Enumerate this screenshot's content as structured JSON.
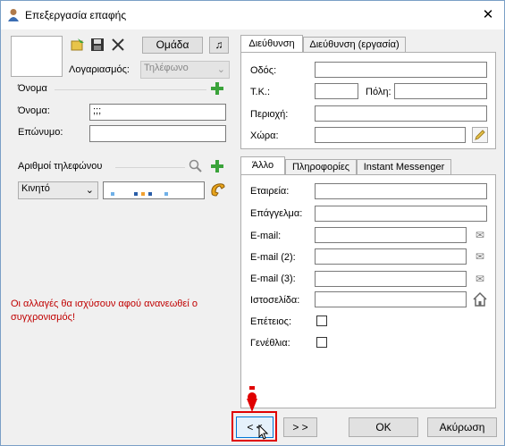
{
  "window": {
    "title": "Επεξεργασία επαφής",
    "close": "✕"
  },
  "left": {
    "group_button": "Ομάδα",
    "account_label": "Λογαριασμός:",
    "account_value": "Τηλέφωνο",
    "name_section": "Όνομα",
    "first_name_label": "Όνομα:",
    "first_name_value": ";;;",
    "last_name_label": "Επώνυμο:",
    "last_name_value": "",
    "phones_section": "Αριθμοί τηλεφώνου",
    "phone_type": "Κινητό",
    "sync_notice": "Οι αλλαγές θα ισχύσουν αφού ανανεωθεί ο συγχρονισμός!"
  },
  "address_tabs": [
    "Διεύθυνση",
    "Διεύθυνση (εργασία)"
  ],
  "address": {
    "street_label": "Οδός:",
    "zip_label": "Τ.Κ.:",
    "city_label": "Πόλη:",
    "region_label": "Περιοχή:",
    "country_label": "Χώρα:"
  },
  "other_tabs": [
    "Άλλο",
    "Πληροφορίες",
    "Instant Messenger"
  ],
  "other": {
    "company_label": "Εταιρεία:",
    "job_label": "Επάγγελμα:",
    "email_label": "E-mail:",
    "email2_label": "E-mail (2):",
    "email3_label": "E-mail (3):",
    "website_label": "Ιστοσελίδα:",
    "anniversary_label": "Επέτειος:",
    "birthday_label": "Γενέθλια:"
  },
  "footer": {
    "prev": "< <",
    "next": "> >",
    "ok": "OK",
    "cancel": "Ακύρωση"
  },
  "colors": {
    "notice": "#c00000",
    "highlight": "#e00000",
    "plus": "#3aa33a"
  }
}
